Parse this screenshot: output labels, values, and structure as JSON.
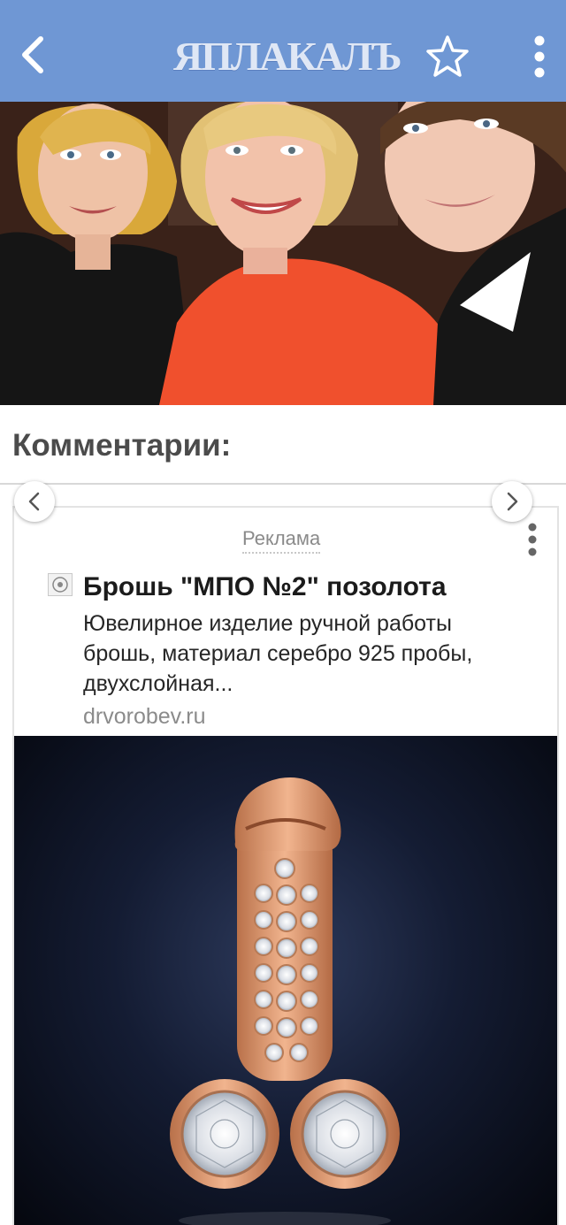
{
  "header": {
    "logo_text": "ЯПЛАКАЛЪ",
    "back_icon": "chevron-left-icon",
    "favorite_icon": "star-outline-icon",
    "menu_icon": "kebab-menu-icon",
    "bar_color": "#6f97d4"
  },
  "post": {
    "image": "photo-three-people-smiling"
  },
  "comments": {
    "title": "Комментарии:"
  },
  "ad": {
    "label": "Реклама",
    "title": "Брошь \"МПО №2\" позолота",
    "description": "Ювелирное изделие ручной работы брошь, материал серебро 925 пробы, двухслойная...",
    "domain": "drvorobev.ru",
    "image": "gold-brooch-with-crystals",
    "prev_icon": "chevron-left-icon",
    "next_icon": "chevron-right-icon"
  }
}
